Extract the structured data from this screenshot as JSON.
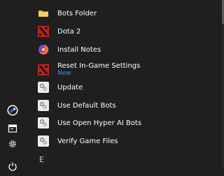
{
  "section_top": "",
  "section_next": "E",
  "colors": {
    "background": "#1f1f1f",
    "text": "#ffffff",
    "accent_new": "#3b8ee6",
    "folder": "#e9b84a",
    "dota": "#b3261e",
    "firefox": "#ff7139"
  },
  "items": [
    {
      "label": "Bots Folder",
      "icon": "folder-icon"
    },
    {
      "label": "Dota 2",
      "icon": "dota-icon"
    },
    {
      "label": "Install Notes",
      "icon": "firefox-icon"
    },
    {
      "label": "Reset In-Game Settings",
      "sub": "New",
      "icon": "dota-icon"
    },
    {
      "label": "Update",
      "icon": "gear-tile-icon"
    },
    {
      "label": "Use Default Bots",
      "icon": "gear-tile-icon"
    },
    {
      "label": "Use Open Hyper AI Bots",
      "icon": "gear-tile-icon"
    },
    {
      "label": "Verify Game Files",
      "icon": "gear-tile-icon"
    }
  ],
  "rail": [
    {
      "icon": "user-avatar-icon"
    },
    {
      "icon": "documents-icon"
    },
    {
      "icon": "settings-icon"
    },
    {
      "icon": "power-icon"
    }
  ]
}
